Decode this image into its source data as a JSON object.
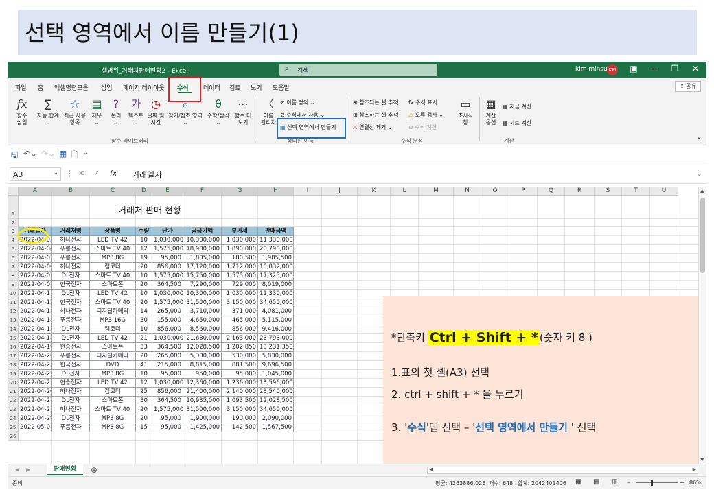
{
  "slide": {
    "title": "선택 영역에서 이름 만들기(1)"
  },
  "window": {
    "title": "셀병위_거래처판매현황2 - Excel",
    "search_placeholder": "검색",
    "user_name": "kim minsu",
    "avatar_initials": "KM"
  },
  "tabs": [
    "파일",
    "홈",
    "엑셀명령모음",
    "삽입",
    "페이지 레이아웃",
    "수식",
    "데이터",
    "검토",
    "보기",
    "도움말"
  ],
  "share_label": "공유",
  "ribbon": {
    "function_library": {
      "buttons": [
        {
          "label1": "함수",
          "label2": "삽입",
          "icon": "fx-icon"
        },
        {
          "label1": "자동 합계",
          "label2": "",
          "icon": "sigma-icon"
        },
        {
          "label1": "최근 사용",
          "label2": "항목",
          "icon": "star-icon"
        },
        {
          "label1": "재무",
          "label2": "",
          "icon": "book-icon"
        },
        {
          "label1": "논리",
          "label2": "",
          "icon": "question-icon"
        },
        {
          "label1": "텍스트",
          "label2": "",
          "icon": "text-icon"
        },
        {
          "label1": "날짜 및",
          "label2": "시간",
          "icon": "clock-icon"
        },
        {
          "label1": "찾기/참조 영역",
          "label2": "",
          "icon": "search-icon"
        },
        {
          "label1": "수학/삼각",
          "label2": "",
          "icon": "theta-icon"
        },
        {
          "label1": "함수 더",
          "label2": "보기",
          "icon": "more-icon"
        }
      ],
      "group_label": "함수 라이브러리"
    },
    "defined_names": {
      "name_manager": {
        "label1": "이름",
        "label2": "관리자"
      },
      "define_name": "이름 정의",
      "use_in_formula": "수식에서 사용",
      "create_from_selection": "선택 영역에서 만들기",
      "group_label": "정의된 이름"
    },
    "formula_auditing": {
      "trace_precedents": "참조되는 셀 추적",
      "trace_dependents": "참조하는 셀 추적",
      "remove_arrows": "연결선 제거",
      "show_formulas": "수식 표시",
      "error_checking": "오류 검사",
      "evaluate_formula": "수식 계산",
      "watch_window": {
        "label1": "조사식",
        "label2": "창"
      },
      "group_label": "수식 분석"
    },
    "calculation": {
      "options": {
        "label1": "계산",
        "label2": "옵션"
      },
      "calc_now": "지금 계산",
      "calc_sheet": "시트 계산",
      "group_label": "계산"
    }
  },
  "formula_bar": {
    "name_box": "A3",
    "content": "거래일자"
  },
  "columns": [
    "A",
    "B",
    "C",
    "D",
    "E",
    "F",
    "G",
    "H",
    "I",
    "J",
    "K",
    "L",
    "M",
    "N",
    "O",
    "P",
    "Q",
    "R",
    "S",
    "T",
    "U"
  ],
  "sheet": {
    "title": "거래처 판매 현황",
    "headers": [
      "거래일자",
      "거래처명",
      "상품명",
      "수량",
      "단가",
      "공급가액",
      "부가세",
      "판매금액"
    ],
    "rows": [
      [
        "2022-04-02",
        "하나전자",
        "LED TV 42",
        "10",
        "1,030,000",
        "10,300,000",
        "1,030,000",
        "11,330,000"
      ],
      [
        "2022-04-04",
        "푸름전자",
        "스마트 TV 40",
        "12",
        "1,575,000",
        "18,900,000",
        "1,890,000",
        "20,790,000"
      ],
      [
        "2022-04-05",
        "푸름전자",
        "MP3 8G",
        "19",
        "95,000",
        "1,805,000",
        "180,500",
        "1,985,500"
      ],
      [
        "2022-04-06",
        "하나전자",
        "캠코더",
        "20",
        "856,000",
        "17,120,000",
        "1,712,000",
        "18,832,000"
      ],
      [
        "2022-04-07",
        "DL전자",
        "스마트 TV 40",
        "10",
        "1,575,000",
        "15,750,000",
        "1,575,000",
        "17,325,000"
      ],
      [
        "2022-04-08",
        "한국전자",
        "스마트폰",
        "20",
        "364,500",
        "7,290,000",
        "729,000",
        "8,019,000"
      ],
      [
        "2022-04-11",
        "DL전자",
        "LED TV 42",
        "10",
        "1,030,000",
        "10,300,000",
        "1,030,000",
        "11,330,000"
      ],
      [
        "2022-04-12",
        "한국전자",
        "스마트 TV 40",
        "20",
        "1,575,000",
        "31,500,000",
        "3,150,000",
        "34,650,000"
      ],
      [
        "2022-04-13",
        "하나전자",
        "디지털카메라",
        "14",
        "265,000",
        "3,710,000",
        "371,000",
        "4,081,000"
      ],
      [
        "2022-04-14",
        "푸름전자",
        "MP3 16G",
        "30",
        "155,000",
        "4,650,000",
        "465,000",
        "5,115,000"
      ],
      [
        "2022-04-15",
        "DL전자",
        "캠코더",
        "10",
        "856,000",
        "8,560,000",
        "856,000",
        "9,416,000"
      ],
      [
        "2022-04-18",
        "DL전자",
        "LED TV 42",
        "21",
        "1,030,000",
        "21,630,000",
        "2,163,000",
        "23,793,000"
      ],
      [
        "2022-04-19",
        "현승전자",
        "스마트폰",
        "33",
        "364,500",
        "12,028,500",
        "1,202,850",
        "13,231,350"
      ],
      [
        "2022-04-20",
        "푸름전자",
        "디지털카메라",
        "20",
        "265,000",
        "5,300,000",
        "530,000",
        "5,830,000"
      ],
      [
        "2022-04-21",
        "한국전자",
        "DVD",
        "41",
        "215,000",
        "8,815,000",
        "881,500",
        "9,696,500"
      ],
      [
        "2022-04-22",
        "DL전자",
        "MP3 8G",
        "10",
        "95,000",
        "950,000",
        "95,000",
        "1,045,000"
      ],
      [
        "2022-04-25",
        "현승전자",
        "LED TV 42",
        "12",
        "1,030,000",
        "12,360,000",
        "1,236,000",
        "13,596,000"
      ],
      [
        "2022-04-26",
        "하나전자",
        "캠코더",
        "25",
        "856,000",
        "21,400,000",
        "2,140,000",
        "23,540,000"
      ],
      [
        "2022-04-27",
        "DL전자",
        "스마트폰",
        "30",
        "364,500",
        "10,935,000",
        "1,093,500",
        "12,028,500"
      ],
      [
        "2022-04-28",
        "하나전자",
        "스마트 TV 40",
        "20",
        "1,575,000",
        "31,500,000",
        "3,150,000",
        "34,650,000"
      ],
      [
        "2022-04-29",
        "DL전자",
        "MP3 8G",
        "20",
        "95,000",
        "1,900,000",
        "190,000",
        "2,090,000"
      ],
      [
        "2022-05-01",
        "푸름전자",
        "MP3 8G",
        "15",
        "95,000",
        "1,425,000",
        "142,500",
        "1,567,500"
      ]
    ]
  },
  "annotation": {
    "shortcut_prefix": "*단축키",
    "shortcut_key": "Ctrl + Shift + *",
    "shortcut_suffix": "(숫자 키 8 )",
    "step1": "1.표의 첫 셀(A3) 선택",
    "step2": "2. ctrl + shift + *  을 누르기",
    "step3_prefix": "3. '",
    "step3_tab": "수식",
    "step3_mid": "'탭 선택 – '",
    "step3_cmd": "선택 영역에서 만들기",
    "step3_suffix": " ' 선택"
  },
  "sheet_tab": "판매현황",
  "status": {
    "ready": "준비",
    "average": "평균: 4263886.025",
    "count": "개수: 648",
    "sum": "합계: 2042401406",
    "zoom": "86%"
  },
  "colors": {
    "excel_green": "#1e7145",
    "header_fill": "#9ec6d8",
    "highlight_red": "#e02020",
    "highlight_blue": "#1f6fbf",
    "highlight_yellow": "#f5e71b",
    "note_bg": "#fce4d9"
  }
}
